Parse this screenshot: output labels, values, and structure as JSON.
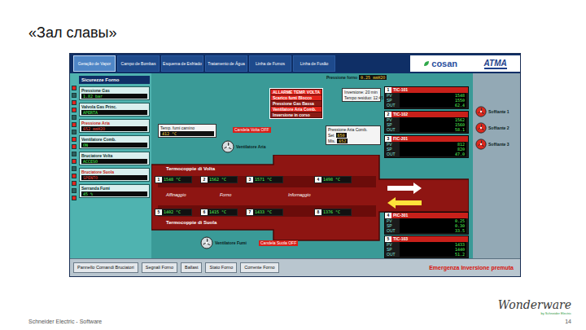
{
  "slide": {
    "title": "«Зал славы»",
    "footer": "Schneider Electric - Software",
    "page": "14"
  },
  "vendor_logo": {
    "name": "Wonderware",
    "by": "by Schneider Electric"
  },
  "hmi": {
    "tabs": [
      {
        "label": "Geração de Vapor",
        "selected": true
      },
      {
        "label": "Campo de Bombas",
        "selected": false
      },
      {
        "label": "Esquema de Esfriado",
        "selected": false
      },
      {
        "label": "Tratamento de Água",
        "selected": false
      },
      {
        "label": "Linha de Fumos",
        "selected": false
      },
      {
        "label": "Linha de Fusão",
        "selected": false
      }
    ],
    "logos": {
      "left": "cosan",
      "right": "ATMA"
    },
    "indicators": [
      {
        "on": true
      },
      {
        "on": false
      },
      {
        "on": true
      },
      {
        "on": true
      },
      {
        "on": false
      },
      {
        "on": true
      },
      {
        "on": false
      },
      {
        "on": true
      },
      {
        "on": true
      },
      {
        "on": false
      },
      {
        "on": true
      },
      {
        "on": false
      },
      {
        "on": true
      },
      {
        "on": true
      },
      {
        "on": false
      },
      {
        "on": true
      }
    ],
    "left_header": "Sicurezze Forno",
    "left_panels": [
      {
        "title": "Pressione Gas",
        "value": "1.82 bar",
        "alarm": false
      },
      {
        "title": "Valvola Gas Princ.",
        "value": "APERTA",
        "alarm": false
      },
      {
        "title": "Pressione Aria",
        "value": "652 mmH2O",
        "alarm": true
      },
      {
        "title": "Ventilatore Comb.",
        "value": "ON",
        "alarm": false
      },
      {
        "title": "Bruciatore Volta",
        "value": "ACCESO",
        "alarm": false
      },
      {
        "title": "Bruciatore Suola",
        "value": "SPENTO",
        "alarm": true
      },
      {
        "title": "Serranda Fumi",
        "value": "45 %",
        "alarm": false
      }
    ],
    "furnace": {
      "top_label": "Termocoppie di Volta",
      "bottom_label": "Termocoppie di Suola",
      "zones": [
        "Affinaggio",
        "Forno",
        "Infornaggio"
      ],
      "volta": [
        {
          "tag": "1",
          "value": "1548 °C"
        },
        {
          "tag": "2",
          "value": "1562 °C"
        },
        {
          "tag": "3",
          "value": "1571 °C"
        },
        {
          "tag": "4",
          "value": "1498 °C"
        }
      ],
      "suola": [
        {
          "tag": "5",
          "value": "1402 °C"
        },
        {
          "tag": "6",
          "value": "1415 °C"
        },
        {
          "tag": "7",
          "value": "1433 °C"
        },
        {
          "tag": "8",
          "value": "1376 °C"
        }
      ]
    },
    "stack_temp": {
      "label": "Temp. fumi camino",
      "value": "412 °C"
    },
    "furnace_pressure": {
      "label": "Pressione forno",
      "value": "0.25 mmH2O"
    },
    "air_panel": {
      "title": "Pressione Aria Comb.",
      "rows": [
        {
          "key": "Set",
          "value": "650"
        },
        {
          "key": "Mis.",
          "value": "652"
        }
      ]
    },
    "alarms": [
      {
        "text": "ALLARME TEMP. VOLTA",
        "active": true
      },
      {
        "text": "Scarico fumi Blocco",
        "active": true
      },
      {
        "text": "Pressione Gas Bassa",
        "active": false
      },
      {
        "text": "Ventilatore Aria Comb.",
        "active": true
      },
      {
        "text": "Inversione in corso",
        "active": false
      }
    ],
    "inversion": [
      "Inversione: 20 min",
      "Tempo residuo: 12:45"
    ],
    "fans": [
      {
        "label": "Ventilatore Aria",
        "running": true
      },
      {
        "label": "Ventilatore Fumi",
        "running": true
      }
    ],
    "ignitors": [
      "Candela Volta OFF",
      "Candela Suola OFF"
    ],
    "instruments": [
      {
        "tag": "1",
        "name": "TIC-101",
        "rows": [
          {
            "key": "PV",
            "value": "1548"
          },
          {
            "key": "SP",
            "value": "1550"
          },
          {
            "key": "OUT",
            "value": "62.4"
          }
        ]
      },
      {
        "tag": "2",
        "name": "TIC-102",
        "rows": [
          {
            "key": "PV",
            "value": "1562"
          },
          {
            "key": "SP",
            "value": "1560"
          },
          {
            "key": "OUT",
            "value": "58.1"
          }
        ]
      },
      {
        "tag": "3",
        "name": "FIC-201",
        "rows": [
          {
            "key": "PV",
            "value": "812"
          },
          {
            "key": "SP",
            "value": "820"
          },
          {
            "key": "OUT",
            "value": "47.0"
          }
        ]
      },
      {
        "tag": "4",
        "name": "PIC-301",
        "rows": [
          {
            "key": "PV",
            "value": "0.25"
          },
          {
            "key": "SP",
            "value": "0.30"
          },
          {
            "key": "OUT",
            "value": "33.5"
          }
        ]
      },
      {
        "tag": "5",
        "name": "TIC-103",
        "rows": [
          {
            "key": "PV",
            "value": "1433"
          },
          {
            "key": "SP",
            "value": "1440"
          },
          {
            "key": "OUT",
            "value": "51.2"
          }
        ]
      }
    ],
    "side_fans": [
      {
        "label": "Soffiante 1",
        "running": false
      },
      {
        "label": "Soffiante 2",
        "running": false
      },
      {
        "label": "Soffiante 3",
        "running": false
      }
    ],
    "buttons": [
      "Pannello Comandi Bruciatori",
      "Segnali Forno",
      "Ballast",
      "Stato Forno",
      "Corrente Forno"
    ],
    "emergency": "Emergenza Inversione premuta"
  }
}
